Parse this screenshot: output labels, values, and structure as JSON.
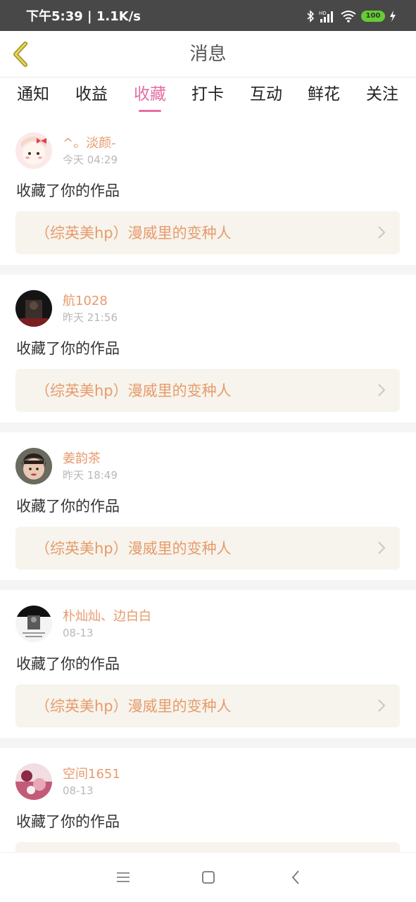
{
  "status_bar": {
    "time": "下午5:39 | 1.1K/s",
    "battery": "100"
  },
  "header": {
    "title": "消息"
  },
  "tabs": [
    {
      "label": "通知"
    },
    {
      "label": "收益"
    },
    {
      "label": "收藏",
      "active": true
    },
    {
      "label": "打卡"
    },
    {
      "label": "互动"
    },
    {
      "label": "鲜花"
    },
    {
      "label": "关注"
    }
  ],
  "messages": [
    {
      "username": "^。淡颜-",
      "time": "今天 04:29",
      "action": "收藏了你的作品",
      "work_title": "（综英美hp）漫威里的变种人"
    },
    {
      "username": "航1028",
      "time": "昨天 21:56",
      "action": "收藏了你的作品",
      "work_title": "（综英美hp）漫威里的变种人"
    },
    {
      "username": "姜韵茶",
      "time": "昨天 18:49",
      "action": "收藏了你的作品",
      "work_title": "（综英美hp）漫威里的变种人"
    },
    {
      "username": "朴灿灿、边白白",
      "time": "08-13",
      "action": "收藏了你的作品",
      "work_title": "（综英美hp）漫威里的变种人"
    },
    {
      "username": "空间1651",
      "time": "08-13",
      "action": "收藏了你的作品",
      "work_title": ""
    }
  ],
  "colors": {
    "accent": "#e56ea3",
    "username": "#e89a6c",
    "card_bg": "#f6f4ec"
  }
}
